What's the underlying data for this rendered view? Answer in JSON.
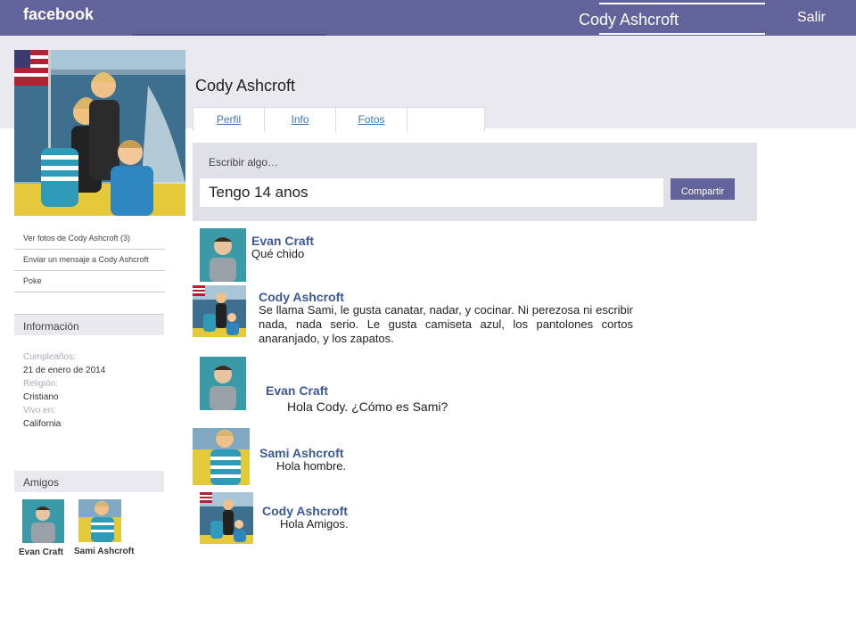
{
  "topbar": {
    "logo": "facebook",
    "user": "Cody Ashcroft",
    "logout": "Salir"
  },
  "profile": {
    "name": "Cody Ashcroft",
    "tabs": [
      "Perfil",
      "Info",
      "Fotos",
      ""
    ]
  },
  "composer": {
    "label": "Escribir algo…",
    "value": "Tengo 14 anos",
    "button": "Compartir"
  },
  "sidebar": {
    "links": [
      "Ver fotos de Cody Ashcroft (3)",
      "Enviar un mensaje a Cody Ashcroft",
      "Poke"
    ],
    "info_header": "Información",
    "info": [
      {
        "key": "Cumpleaños:",
        "value": "21 de enero de 2014"
      },
      {
        "key": "Religión:",
        "value": "Cristiano"
      },
      {
        "key": "Vivo en:",
        "value": "California"
      }
    ],
    "friends_header": "Amigos",
    "friends": [
      "Evan Craft",
      "Sami Ashcroft"
    ]
  },
  "posts": [
    {
      "author": "Evan Craft",
      "text": "Qué chido",
      "avatar": "evan"
    },
    {
      "author": "Cody Ashcroft",
      "text": "Se llama Sami, le gusta canatar, nadar, y cocinar. Ni perezosa ni escribir nada, nada serio. Le gusta camiseta azul, los pantolones cortos anaranjado, y los zapatos.",
      "avatar": "cody"
    },
    {
      "author": "Evan Craft",
      "text": "Hola Cody. ¿Cómo es Sami?",
      "avatar": "evan"
    },
    {
      "author": "Sami Ashcroft",
      "text": "Hola hombre.",
      "avatar": "sami"
    },
    {
      "author": "Cody Ashcroft",
      "text": "Hola Amigos.",
      "avatar": "cody"
    }
  ]
}
